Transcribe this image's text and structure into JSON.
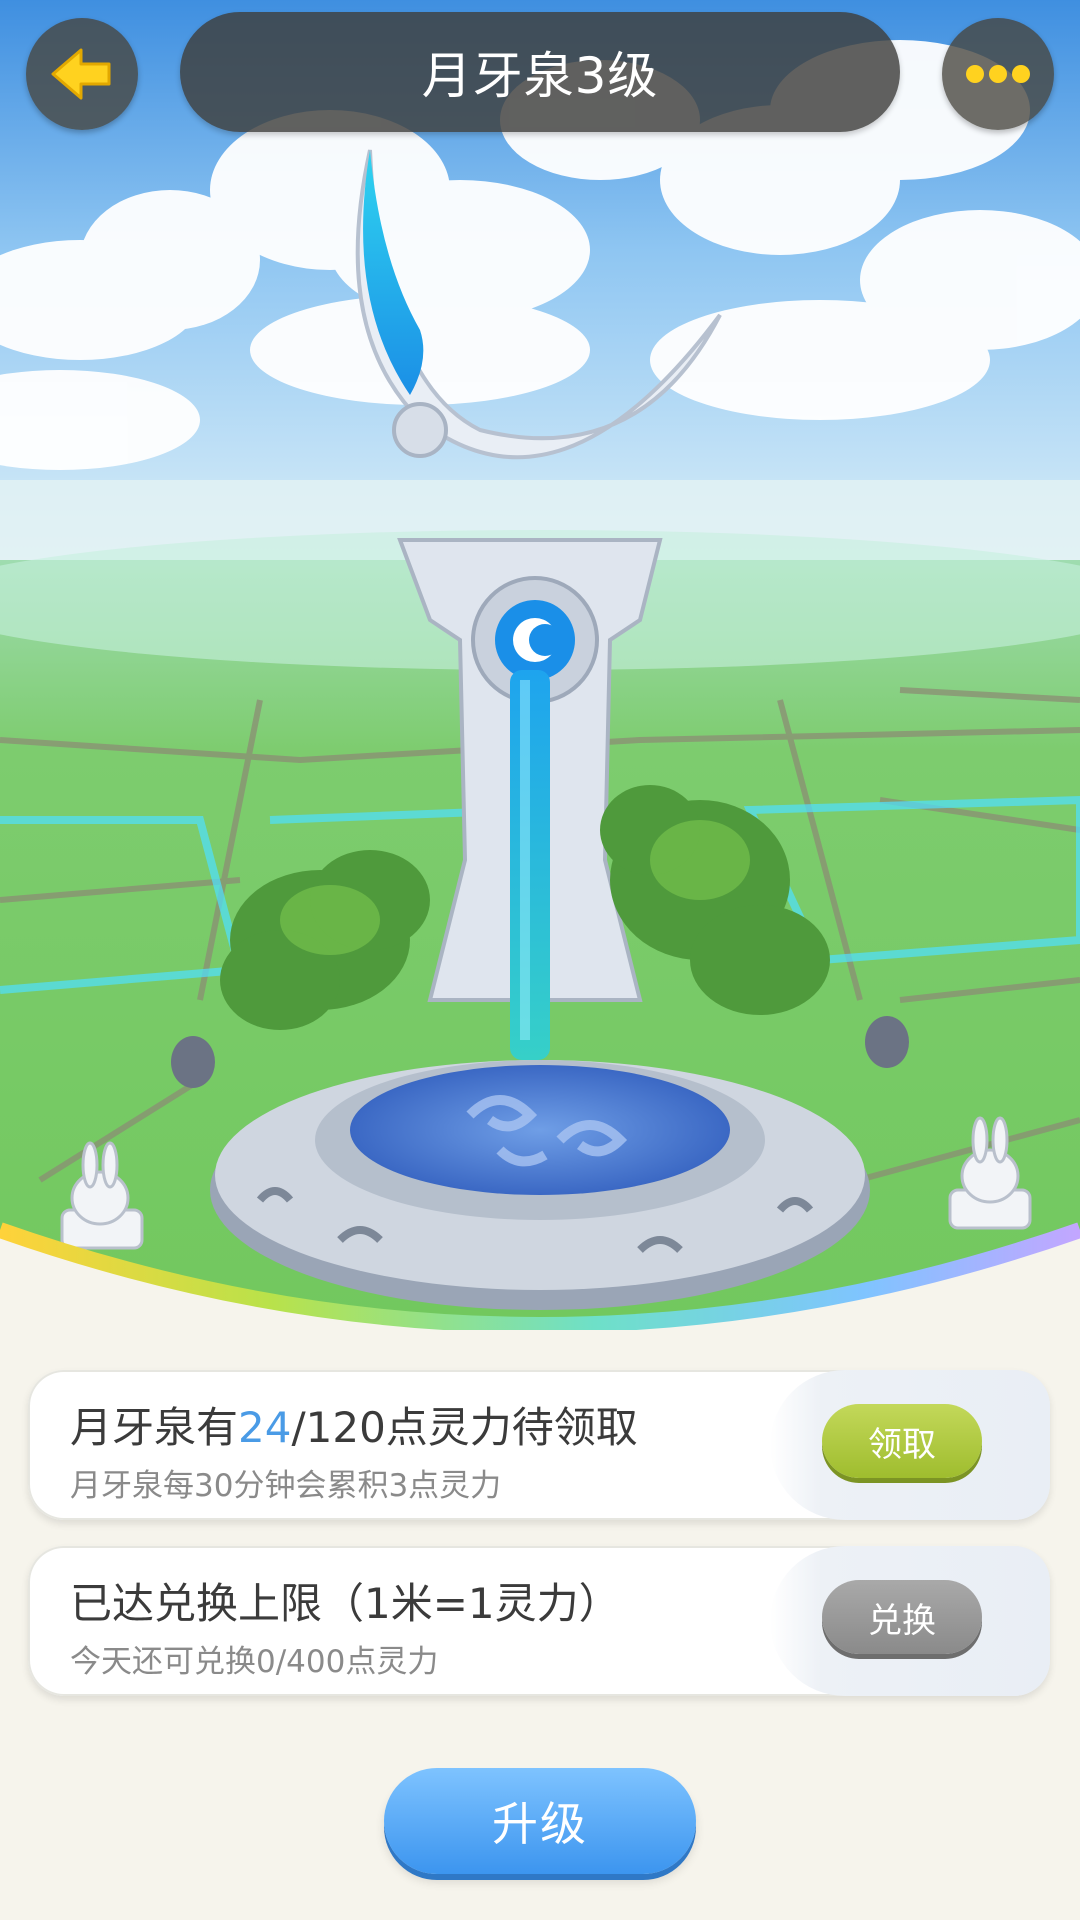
{
  "header": {
    "title": "月牙泉3级",
    "back_icon": "back-arrow-icon",
    "more_icon": "more-dots-icon"
  },
  "scene": {
    "description_icon": "crescent-moon-fountain"
  },
  "claim_card": {
    "prefix": "月牙泉有",
    "current": "24",
    "suffix": "/120点灵力待领取",
    "subtitle": "月牙泉每30分钟会累积3点灵力",
    "button_label": "领取",
    "button_color": "#a9c63c"
  },
  "exchange_card": {
    "title": "已达兑换上限（1米=1灵力）",
    "subtitle": "今天还可兑换0/400点灵力",
    "button_label": "兑换",
    "button_color": "#999999"
  },
  "upgrade": {
    "label": "升级",
    "color": "#4aa3f5"
  },
  "colors": {
    "accent_blue": "#4a9be6",
    "background": "#f6f4ec"
  }
}
